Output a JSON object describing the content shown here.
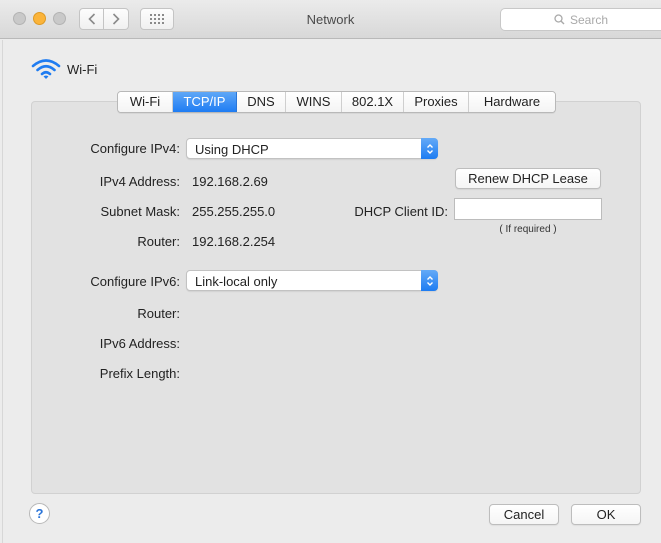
{
  "window": {
    "title": "Network"
  },
  "toolbar": {
    "search_placeholder": "Search",
    "back_icon": "chevron-left-icon",
    "forward_icon": "chevron-right-icon",
    "grid_icon": "grid-icon"
  },
  "interface": {
    "name": "Wi-Fi",
    "icon": "wifi-icon"
  },
  "tabs": [
    {
      "label": "Wi-Fi",
      "active": false
    },
    {
      "label": "TCP/IP",
      "active": true
    },
    {
      "label": "DNS",
      "active": false
    },
    {
      "label": "WINS",
      "active": false
    },
    {
      "label": "802.1X",
      "active": false
    },
    {
      "label": "Proxies",
      "active": false
    },
    {
      "label": "Hardware",
      "active": false
    }
  ],
  "ipv4": {
    "configure_label": "Configure IPv4:",
    "configure_value": "Using DHCP",
    "address_label": "IPv4 Address:",
    "address_value": "192.168.2.69",
    "subnet_label": "Subnet Mask:",
    "subnet_value": "255.255.255.0",
    "router_label": "Router:",
    "router_value": "192.168.2.254",
    "renew_button": "Renew DHCP Lease",
    "client_id_label": "DHCP Client ID:",
    "client_id_value": "",
    "client_id_note": "( If required )"
  },
  "ipv6": {
    "configure_label": "Configure IPv6:",
    "configure_value": "Link-local only",
    "router_label": "Router:",
    "address_label": "IPv6 Address:",
    "prefix_label": "Prefix Length:"
  },
  "footer": {
    "help": "?",
    "cancel": "Cancel",
    "ok": "OK"
  },
  "colors": {
    "accent": "#1e7cf3",
    "window_bg": "#ececec",
    "panel_bg": "#e2e2e2"
  }
}
